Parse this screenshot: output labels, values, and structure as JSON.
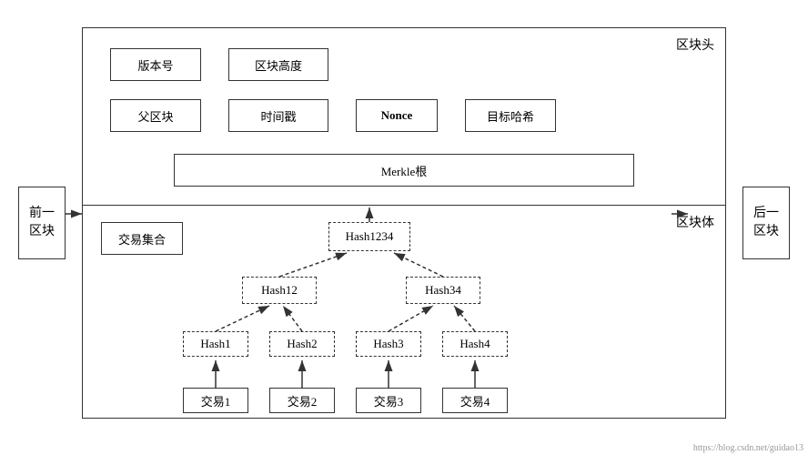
{
  "prev_block": {
    "label": "前一\n区块"
  },
  "next_block": {
    "label": "后一\n区块"
  },
  "header_label": "区块头",
  "body_label": "区块体",
  "boxes": {
    "version": "版本号",
    "height": "区块高度",
    "parent": "父区块",
    "timestamp": "时间戳",
    "nonce": "Nonce",
    "target_hash": "目标哈希",
    "merkle": "Merkle根",
    "tx_set": "交易集合",
    "hash1234": "Hash1234",
    "hash12": "Hash12",
    "hash34": "Hash34",
    "hash1": "Hash1",
    "hash2": "Hash2",
    "hash3": "Hash3",
    "hash4": "Hash4",
    "tx1": "交易1",
    "tx2": "交易2",
    "tx3": "交易3",
    "tx4": "交易4"
  },
  "watermark": "https://blog.csdn.net/guidao13"
}
